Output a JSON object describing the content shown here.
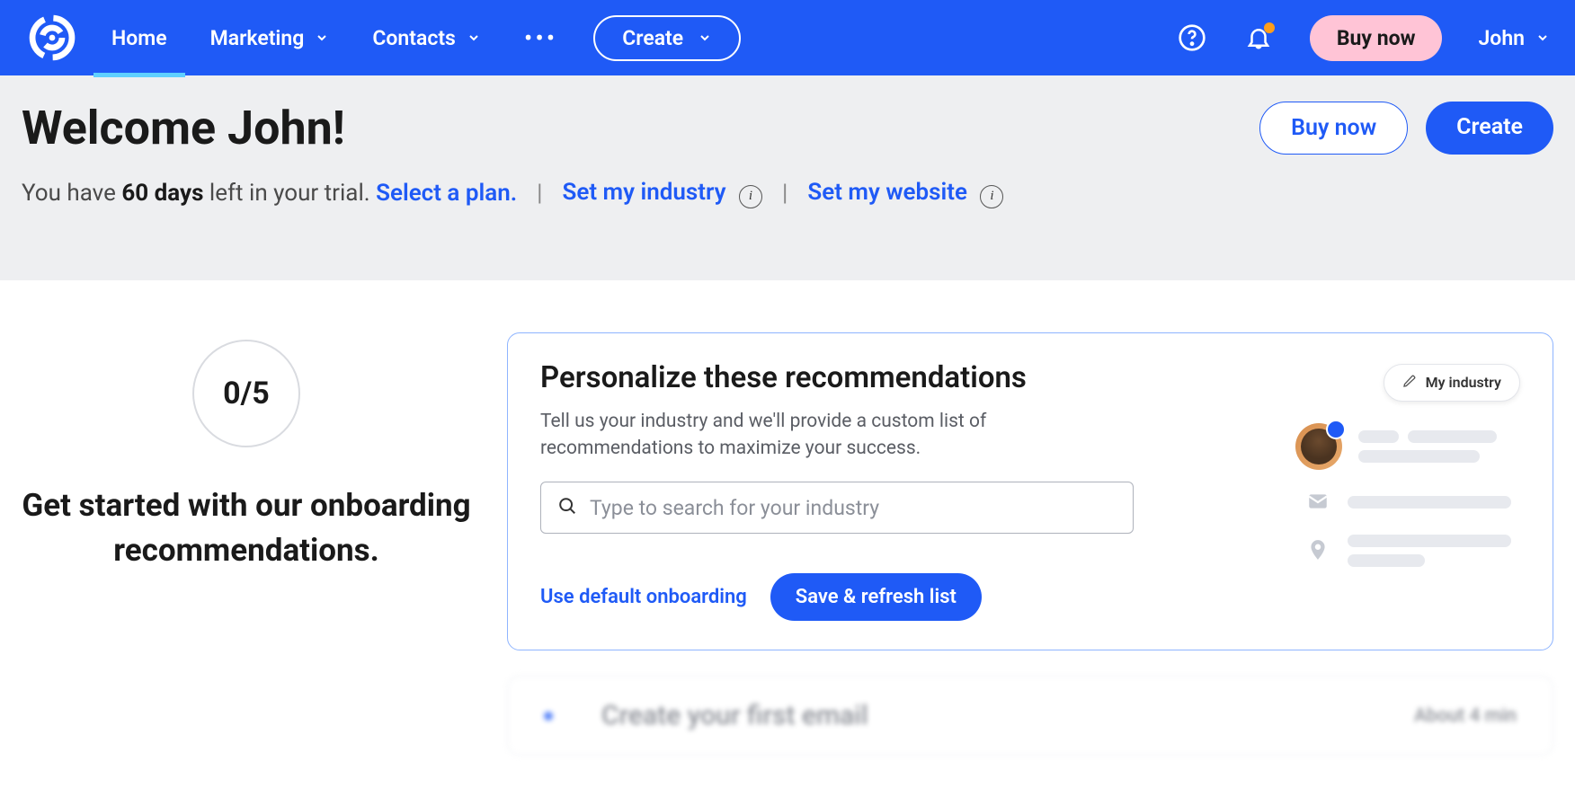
{
  "nav": {
    "home": "Home",
    "marketing": "Marketing",
    "contacts": "Contacts",
    "create": "Create",
    "buy_now": "Buy now",
    "user": "John"
  },
  "header": {
    "title": "Welcome John!",
    "buy_now": "Buy now",
    "create": "Create",
    "trial_prefix": "You have ",
    "trial_days": "60 days",
    "trial_suffix": " left in your trial. ",
    "select_plan": "Select a plan.",
    "set_industry": "Set my industry",
    "set_website": "Set my website"
  },
  "onboarding": {
    "progress": "0/5",
    "heading": "Get started with our onboarding recommendations."
  },
  "card": {
    "title": "Personalize these recommendations",
    "desc": "Tell us your industry and we'll provide a custom list of recommendations to maximize your success.",
    "search_placeholder": "Type to search for your industry",
    "use_default": "Use default onboarding",
    "save_refresh": "Save & refresh list",
    "my_industry": "My industry"
  },
  "next": {
    "title": "Create your first email",
    "time": "About 4 min"
  }
}
